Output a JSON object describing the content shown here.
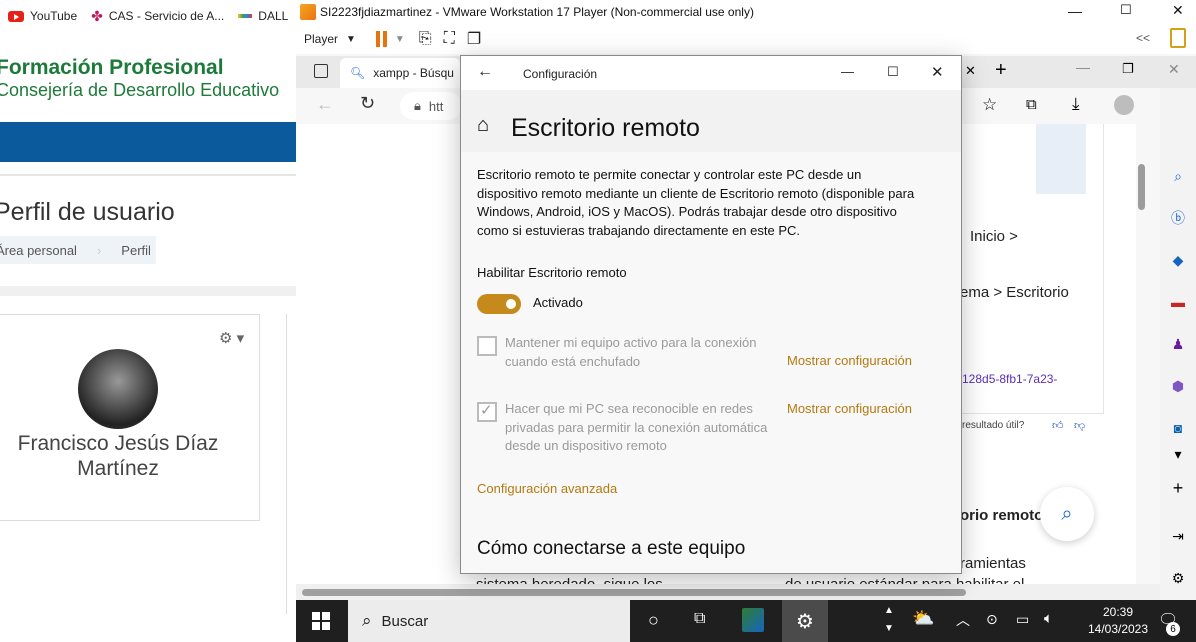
{
  "bookmarks": [
    {
      "label": "YouTube",
      "icon": "youtube-icon"
    },
    {
      "label": "CAS - Servicio de A...",
      "icon": "cas-icon"
    },
    {
      "label": "DALL",
      "icon": "dall-icon"
    }
  ],
  "host": {
    "brand_title": "Formación Profesional",
    "brand_subtitle": "Consejería de Desarrollo Educativo",
    "page_title": "Perfil de usuario",
    "breadcrumb": [
      "Área personal",
      "Perfil"
    ],
    "user_name": "Francisco Jesús Díaz Martínez"
  },
  "vmware": {
    "title": "SI2223fjdiazmartinez - VMware Workstation 17 Player (Non-commercial use only)",
    "player_menu": "Player",
    "colors": {
      "pause": "#e8730c",
      "accent": "#d4a017"
    }
  },
  "edge": {
    "tab_label": "xampp - Búsqu",
    "address": "htt",
    "snippets": {
      "s1": "Inicio >",
      "s2": "ema > Escritorio",
      "s3": "128d5-8fb1-7a23-",
      "s4": "resultado útil?",
      "s5": "orio remoto",
      "s6": "ramientas",
      "s7": "de usuario estándar para habilitar el",
      "s8": "sistema heredado, sigue los"
    }
  },
  "settings": {
    "window_title": "Configuración",
    "page_title": "Escritorio remoto",
    "description": "Escritorio remoto te permite conectar y controlar este PC desde un dispositivo remoto mediante un cliente de Escritorio remoto (disponible para Windows, Android, iOS y MacOS). Podrás trabajar desde otro dispositivo como si estuvieras trabajando directamente en este PC.",
    "enable_label": "Habilitar Escritorio remoto",
    "toggle_state": "Activado",
    "option1_text": "Mantener mi equipo activo para la conexión cuando está enchufado",
    "option1_checked": false,
    "option2_text": "Hacer que mi PC sea reconocible en redes privadas para permitir la conexión automática desde un dispositivo remoto",
    "option2_checked": true,
    "show_settings": "Mostrar configuración",
    "advanced": "Configuración avanzada",
    "how_to_connect": "Cómo conectarse a este equipo"
  },
  "taskbar": {
    "search": "Buscar",
    "time": "20:39",
    "date": "14/03/2023",
    "notification_count": "6"
  }
}
